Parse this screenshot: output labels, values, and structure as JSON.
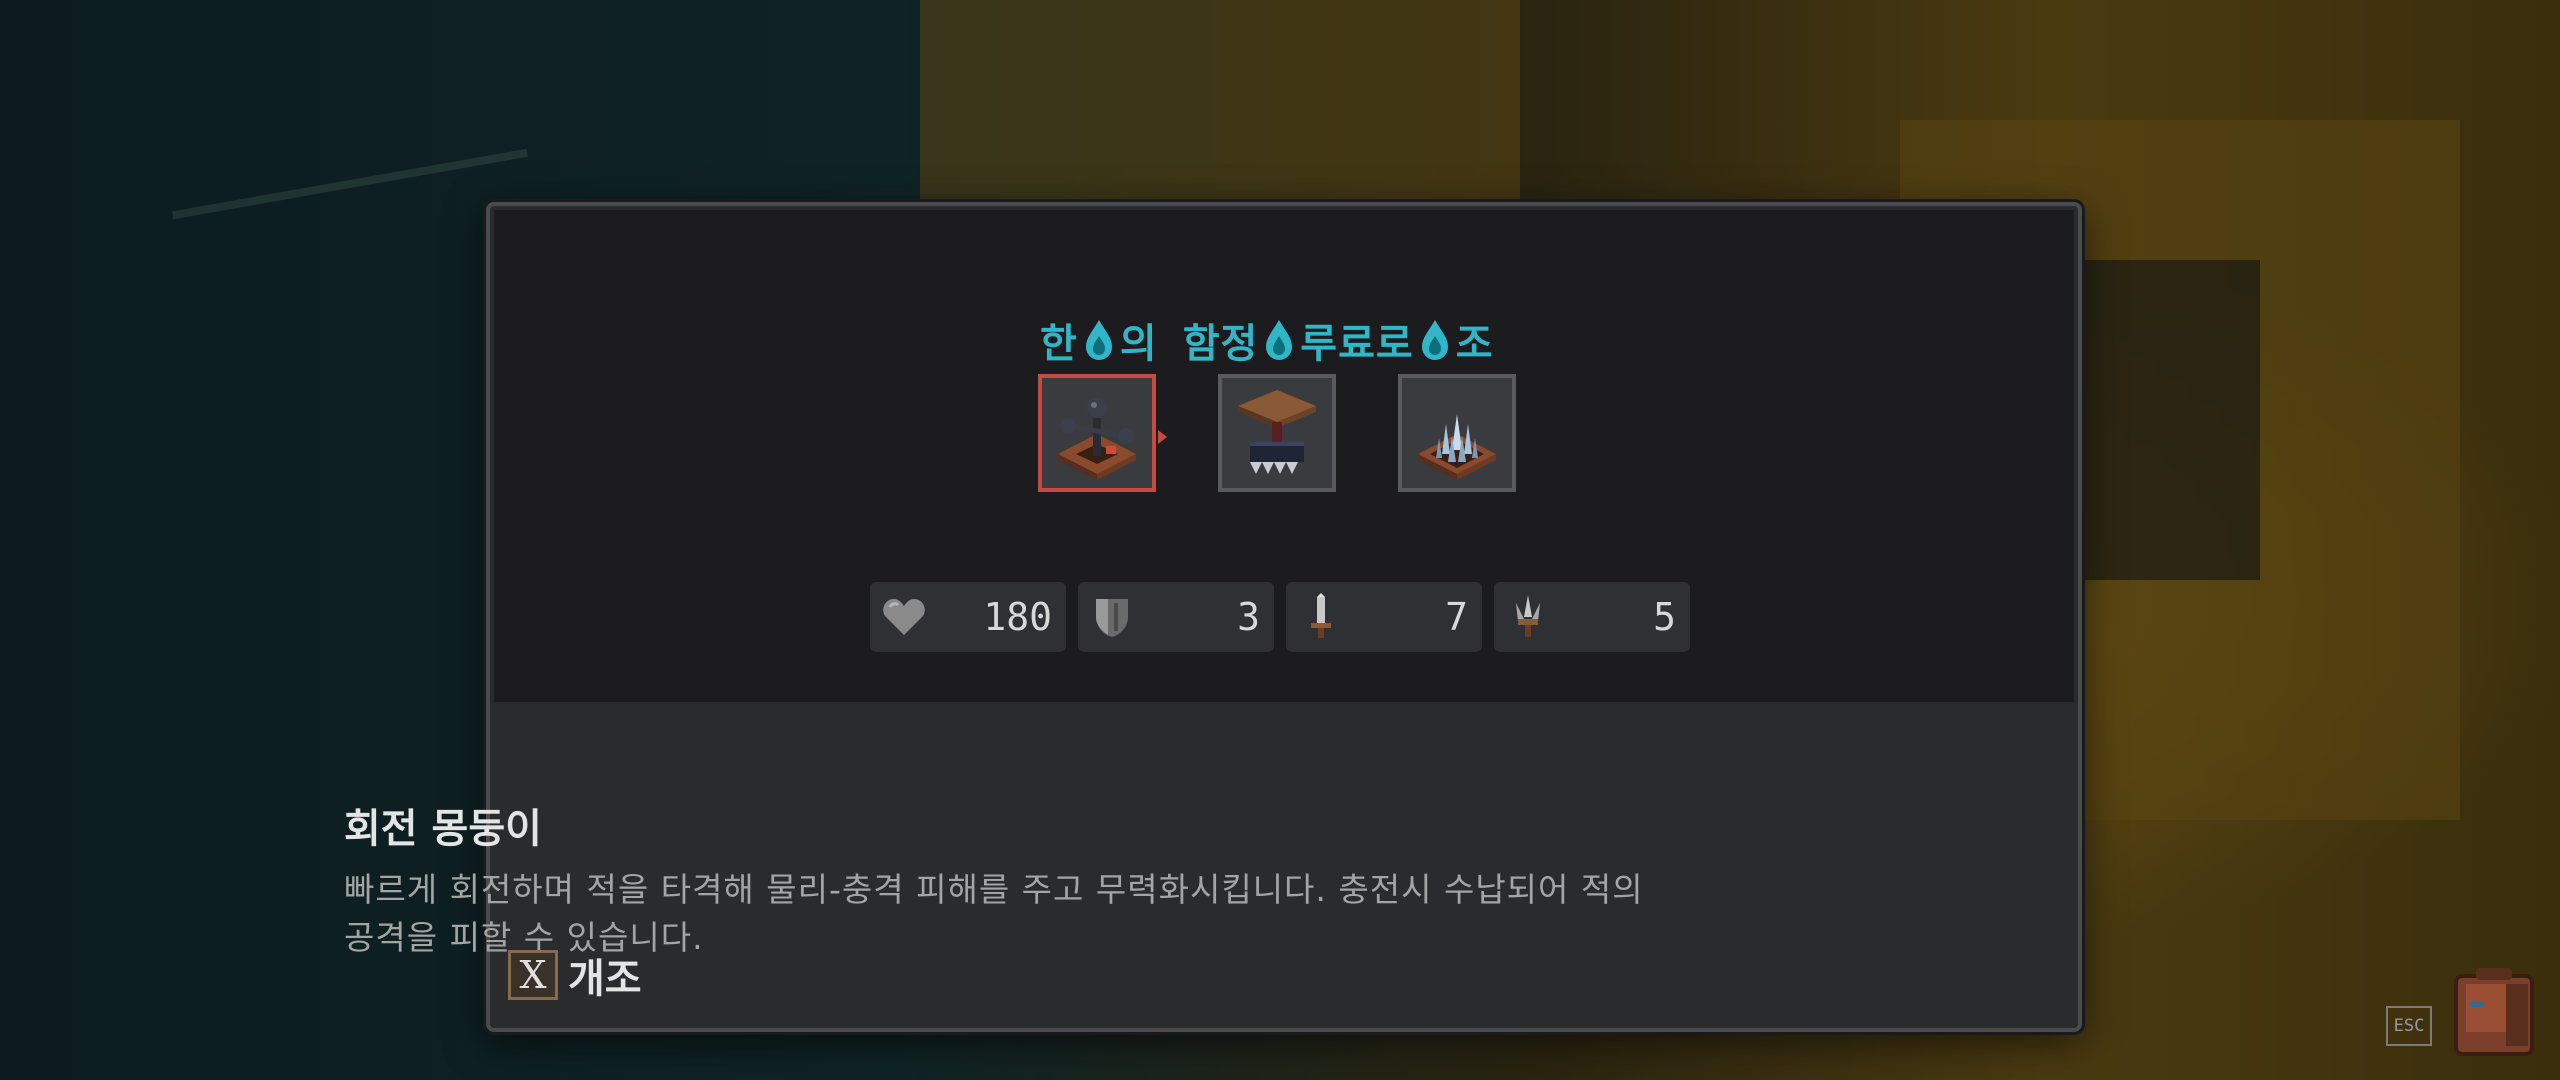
{
  "trap_panel": {
    "title_parts": [
      "한",
      "의 함정",
      "루료로",
      "조"
    ],
    "slots": [
      {
        "name": "rotating-club",
        "selected": true
      },
      {
        "name": "crusher",
        "selected": false
      },
      {
        "name": "spike",
        "selected": false
      }
    ],
    "stats": {
      "health": "180",
      "armor": "3",
      "attack": "7",
      "spike_damage": "5"
    }
  },
  "description": {
    "title": "회전 몽둥이",
    "line1": "빠르게 회전하며 적을 타격해 물리-충격 피해를 주고 무력화시킵니다. 충전시 수납되어 적의",
    "line2": "공격을 피할 수 있습니다."
  },
  "action": {
    "key": "X",
    "label": "개조"
  },
  "system": {
    "esc_label": "ESC"
  },
  "colors": {
    "title_cyan": "#2fb7c9",
    "selected_border": "#c24b43",
    "panel_bg": "#2a2b2c"
  }
}
